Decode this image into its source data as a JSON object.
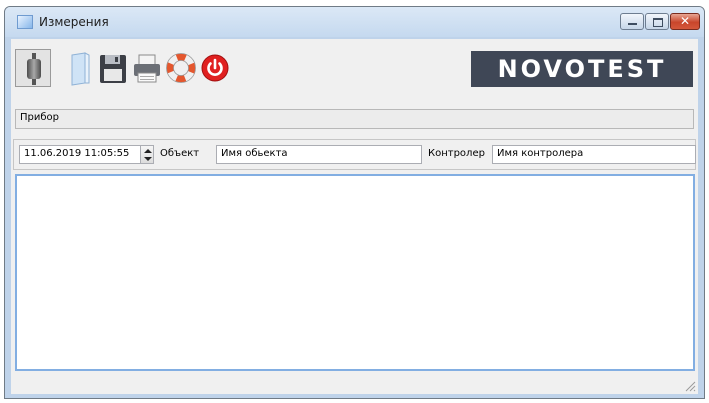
{
  "window": {
    "title": "Измерения"
  },
  "toolbar": {
    "buttons": [
      {
        "name": "device-connect",
        "icon": "probe-icon"
      },
      {
        "name": "open",
        "icon": "document-icon"
      },
      {
        "name": "save",
        "icon": "floppy-disk-icon"
      },
      {
        "name": "print",
        "icon": "printer-icon"
      },
      {
        "name": "help",
        "icon": "lifebuoy-icon"
      },
      {
        "name": "exit",
        "icon": "power-icon"
      }
    ],
    "logo_text": "NOVOTEST"
  },
  "device": {
    "label": "Прибор"
  },
  "params": {
    "datetime": "11.06.2019 11:05:55",
    "object_label": "Объект",
    "object_value": "Имя обьекта",
    "controller_label": "Контролер",
    "controller_value": "Имя контролера"
  },
  "colors": {
    "logo_bg": "#3f4756",
    "accent": "#82aee2",
    "power": "#e02020"
  }
}
